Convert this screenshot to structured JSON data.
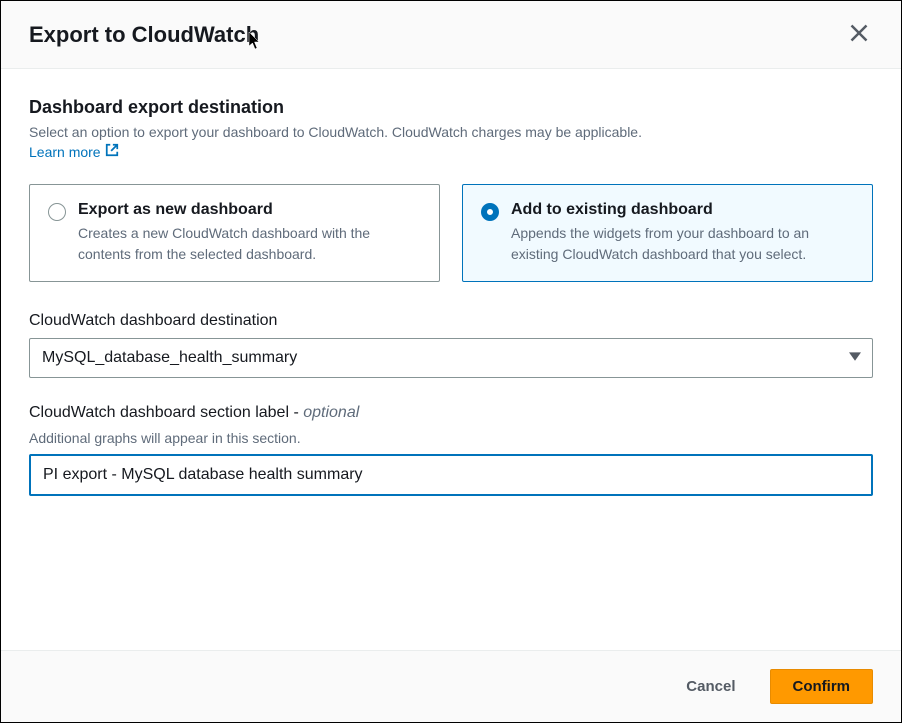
{
  "dialog": {
    "title": "Export to CloudWatch"
  },
  "destination": {
    "title": "Dashboard export destination",
    "description": "Select an option to export your dashboard to CloudWatch. CloudWatch charges may be applicable.",
    "learn_more": "Learn more"
  },
  "options": {
    "new": {
      "title": "Export as new dashboard",
      "description": "Creates a new CloudWatch dashboard with the contents from the selected dashboard."
    },
    "existing": {
      "title": "Add to existing dashboard",
      "description": "Appends the widgets from your dashboard to an existing CloudWatch dashboard that you select."
    }
  },
  "dashboard_select": {
    "label": "CloudWatch dashboard destination",
    "value": "MySQL_database_health_summary"
  },
  "section_label": {
    "label": "CloudWatch dashboard section label - ",
    "optional": "optional",
    "help": "Additional graphs will appear in this section.",
    "value": "PI export - MySQL database health summary"
  },
  "buttons": {
    "cancel": "Cancel",
    "confirm": "Confirm"
  }
}
